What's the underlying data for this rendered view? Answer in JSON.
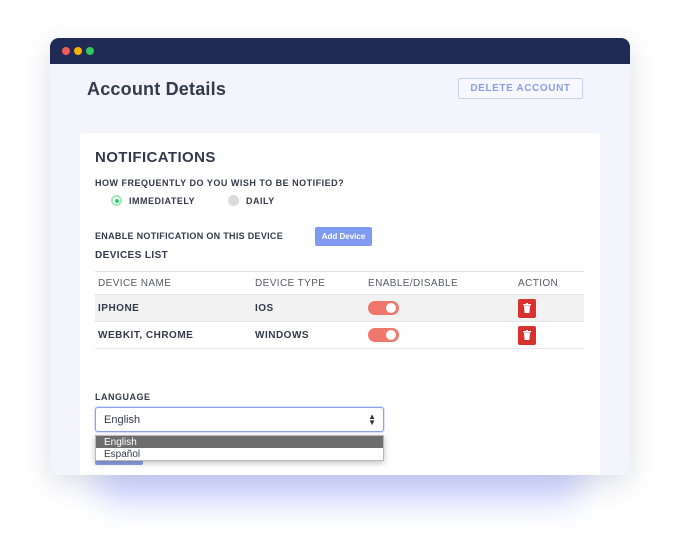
{
  "window": {
    "title": "Account Details",
    "delete_label": "DELETE ACCOUNT"
  },
  "notifications": {
    "title": "NOTIFICATIONS",
    "question": "HOW FREQUENTLY DO YOU WISH TO BE NOTIFIED?",
    "options": [
      {
        "label": "IMMEDIATELY",
        "selected": true
      },
      {
        "label": "DAILY",
        "selected": false
      }
    ],
    "enable_label": "ENABLE NOTIFICATION ON THIS DEVICE",
    "add_device_label": "Add Device"
  },
  "devices": {
    "title": "DEVICES LIST",
    "columns": [
      "DEVICE NAME",
      "DEVICE TYPE",
      "ENABLE/DISABLE",
      "ACTION"
    ],
    "rows": [
      {
        "name": "IPHONE",
        "type": "IOS",
        "enabled": true
      },
      {
        "name": "WEBKIT, CHROME",
        "type": "WINDOWS",
        "enabled": true
      }
    ]
  },
  "language": {
    "label": "LANGUAGE",
    "selected": "English",
    "options": [
      "English",
      "Español"
    ]
  },
  "colors": {
    "titlebar": "#1f2a55",
    "accent": "#7f9af3",
    "toggle_on": "#f0776b",
    "delete": "#d9312f",
    "radio_on": "#2fce78"
  },
  "icons": {
    "window_controls": [
      "close-dot",
      "minimize-dot",
      "maximize-dot"
    ],
    "row_action": "trash-icon",
    "select_arrow": "up-down-chevron-icon"
  }
}
